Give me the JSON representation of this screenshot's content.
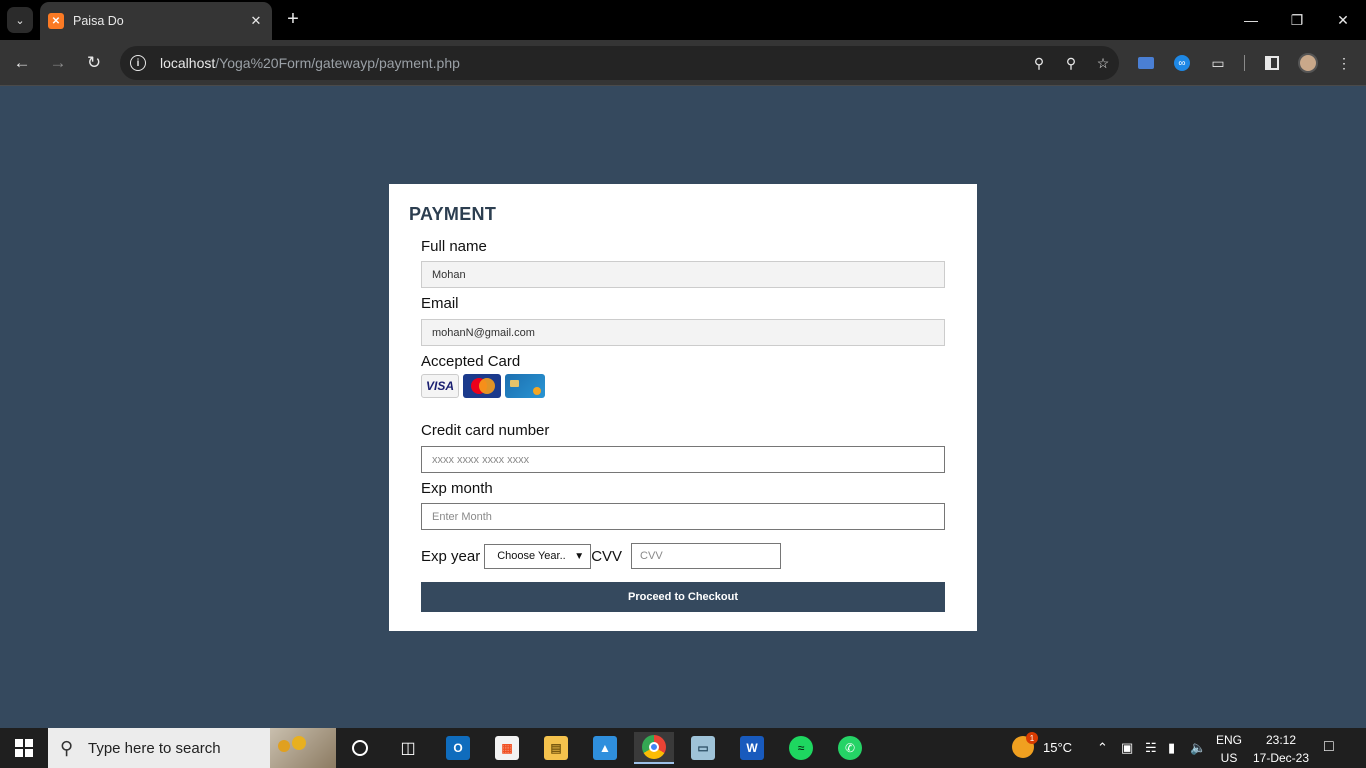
{
  "browser": {
    "tab_title": "Paisa Do",
    "tab_favicon": "xampp-favicon",
    "url_host": "localhost",
    "url_path": "/Yoga%20Form/gatewayp/payment.php"
  },
  "form": {
    "heading": "PAYMENT",
    "full_name_label": "Full name",
    "full_name_value": "Mohan",
    "email_label": "Email",
    "email_value": "mohanN@gmail.com",
    "accepted_card_label": "Accepted Card",
    "accepted_cards": [
      "VISA",
      "MasterCard",
      "generic-card"
    ],
    "visa_text": "VISA",
    "cc_number_label": "Credit card number",
    "cc_number_placeholder": "xxxx xxxx xxxx xxxx",
    "exp_month_label": "Exp month",
    "exp_month_placeholder": "Enter Month",
    "exp_year_label": "Exp year",
    "exp_year_selected": "Choose Year..",
    "cvv_label": "CVV",
    "cvv_placeholder": "CVV",
    "checkout_button": "Proceed to Checkout"
  },
  "taskbar": {
    "search_placeholder": "Type here to search",
    "weather_temp": "15°C",
    "weather_badge": "1",
    "lang_line1": "ENG",
    "lang_line2": "US",
    "time": "23:12",
    "date": "17-Dec-23"
  },
  "colors": {
    "page_bg": "#35495e",
    "button_bg": "#35495e",
    "heading": "#2c3e50"
  }
}
